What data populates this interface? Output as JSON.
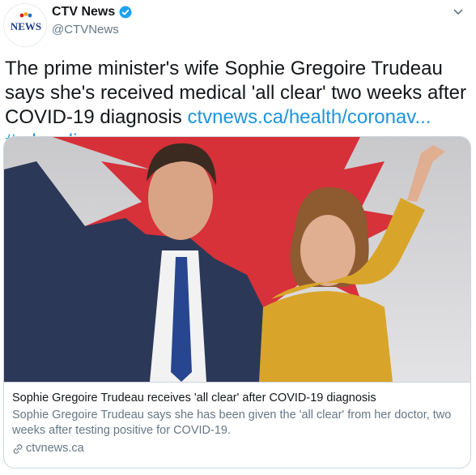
{
  "account": {
    "display_name": "CTV News",
    "handle": "@CTVNews",
    "avatar_logo_text": "CTV NEWS",
    "verified": true
  },
  "tweet": {
    "text_plain": "The prime minister's wife Sophie Gregoire Trudeau says she's received medical 'all clear' two weeks after COVID-19 diagnosis",
    "link_text": "ctvnews.ca/health/coronav...",
    "hashtag": "#cdnpoli"
  },
  "card": {
    "image_alt": "Justin Trudeau and Sophie Gregoire Trudeau waving on stage",
    "title": "Sophie Gregoire Trudeau receives 'all clear' after COVID-19 diagnosis",
    "description": "Sophie Gregoire Trudeau says she has been given the 'all clear' from her doctor, two weeks after testing positive for COVID-19.",
    "domain": "ctvnews.ca"
  },
  "icons": {
    "verified": "verified-badge-icon",
    "more": "chevron-down-icon",
    "link": "link-icon"
  },
  "colors": {
    "link": "#1b95e0",
    "secondary_text": "#657786",
    "verified": "#1da1f2"
  }
}
